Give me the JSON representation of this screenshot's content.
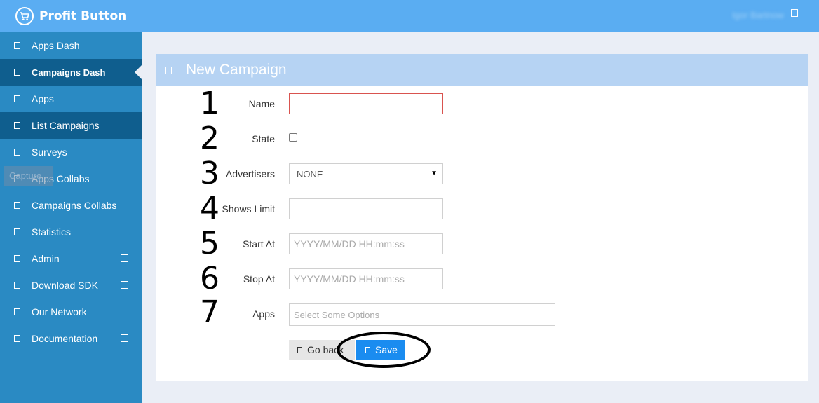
{
  "app": {
    "name": "Profit Button",
    "user": "Igor Bartnow"
  },
  "capture_label": "Capture",
  "sidebar": {
    "items": [
      {
        "label": "Apps Dash",
        "expandable": false,
        "active": false
      },
      {
        "label": "Campaigns Dash",
        "expandable": false,
        "active": true
      },
      {
        "label": "Apps",
        "expandable": true,
        "active": false
      },
      {
        "label": "List Campaigns",
        "expandable": false,
        "active": true
      },
      {
        "label": "Surveys",
        "expandable": false,
        "active": false
      },
      {
        "label": "Apps Collabs",
        "expandable": false,
        "active": false
      },
      {
        "label": "Campaigns Collabs",
        "expandable": false,
        "active": false
      },
      {
        "label": "Statistics",
        "expandable": true,
        "active": false
      },
      {
        "label": "Admin",
        "expandable": true,
        "active": false
      },
      {
        "label": "Download SDK",
        "expandable": true,
        "active": false
      },
      {
        "label": "Our Network",
        "expandable": false,
        "active": false
      },
      {
        "label": "Documentation",
        "expandable": true,
        "active": false
      }
    ]
  },
  "panel": {
    "title": "New Campaign"
  },
  "form": {
    "name": {
      "number": "1",
      "label": "Name",
      "value": ""
    },
    "state": {
      "number": "2",
      "label": "State",
      "checked": false
    },
    "advertisers": {
      "number": "3",
      "label": "Advertisers",
      "value": "NONE"
    },
    "shows_limit": {
      "number": "4",
      "label": "Shows Limit",
      "value": ""
    },
    "start_at": {
      "number": "5",
      "label": "Start At",
      "placeholder": "YYYY/MM/DD HH:mm:ss"
    },
    "stop_at": {
      "number": "6",
      "label": "Stop At",
      "placeholder": "YYYY/MM/DD HH:mm:ss"
    },
    "apps": {
      "number": "7",
      "label": "Apps",
      "placeholder": "Select Some Options"
    }
  },
  "buttons": {
    "go_back": "Go back",
    "save": "Save"
  },
  "colors": {
    "topbar": "#5aadf2",
    "sidebar": "#2a8ac3",
    "sidebar_active": "#0f5e8e",
    "panel_header": "#b6d3f3",
    "save_button": "#1a8cf0"
  }
}
